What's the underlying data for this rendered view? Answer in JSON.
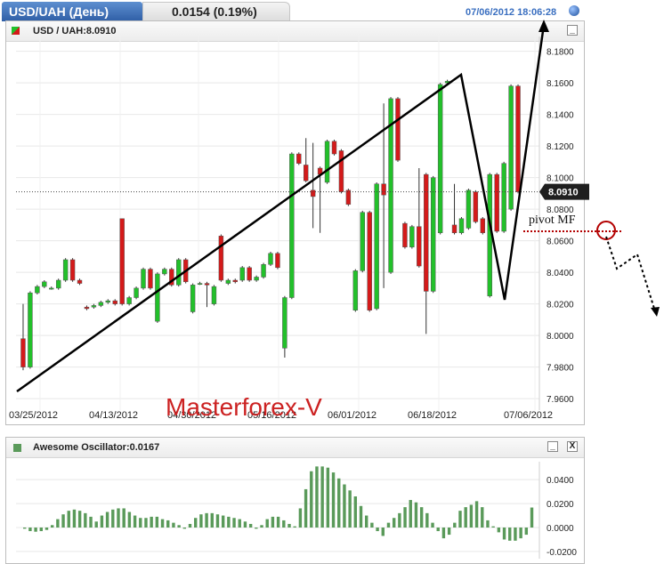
{
  "header": {
    "symbol_tab": "USD/UAH (День)",
    "price_change": "0.0154 (0.19%)",
    "timestamp": "07/06/2012 18:06:28"
  },
  "main_panel": {
    "title": "USD / UAH:8.0910",
    "minimize": "_",
    "last_price_tag": "8.0910",
    "pivot_label": "pivot MF",
    "watermark": "Masterforex-V",
    "colors": {
      "up": "#22c02a",
      "down": "#d41a1a",
      "trendline": "#000000",
      "pivot": "#b30000",
      "tag": "#1f1f1f"
    }
  },
  "osc_panel": {
    "title": "Awesome Oscillator:0.0167",
    "minimize": "_",
    "close": "X",
    "color": "#5a9a5a"
  },
  "chart_data": [
    {
      "type": "candlestick",
      "title": "USD / UAH:8.0910",
      "y_ticks": [
        "8.1800",
        "8.1600",
        "8.1400",
        "8.1200",
        "8.1000",
        "8.0800",
        "8.0600",
        "8.0400",
        "8.0200",
        "8.0000",
        "7.9800",
        "7.9600"
      ],
      "x_ticks": [
        "03/25/2012",
        "04/13/2012",
        "04/30/2012",
        "05/16/2012",
        "06/01/2012",
        "06/18/2012",
        "07/06/2012"
      ],
      "ylim": [
        7.955,
        8.186
      ],
      "candles": [
        [
          7.998,
          7.98,
          8.02,
          7.978
        ],
        [
          7.98,
          8.027,
          8.028,
          7.979
        ],
        [
          8.027,
          8.031,
          8.032,
          8.026
        ],
        [
          8.031,
          8.034,
          8.035,
          8.03
        ],
        [
          8.03,
          8.03,
          8.031,
          8.029
        ],
        [
          8.03,
          8.035,
          8.036,
          8.029
        ],
        [
          8.035,
          8.048,
          8.049,
          8.034
        ],
        [
          8.048,
          8.035,
          8.049,
          8.034
        ],
        [
          8.035,
          8.033,
          8.036,
          8.032
        ],
        [
          8.018,
          8.017,
          8.019,
          8.016
        ],
        [
          8.018,
          8.019,
          8.02,
          8.017
        ],
        [
          8.019,
          8.021,
          8.022,
          8.018
        ],
        [
          8.021,
          8.022,
          8.023,
          8.02
        ],
        [
          8.022,
          8.02,
          8.023,
          8.019
        ],
        [
          8.074,
          8.02,
          8.074,
          8.019
        ],
        [
          8.02,
          8.024,
          8.025,
          8.019
        ],
        [
          8.024,
          8.03,
          8.031,
          8.023
        ],
        [
          8.03,
          8.042,
          8.043,
          8.029
        ],
        [
          8.042,
          8.03,
          8.043,
          8.029
        ],
        [
          8.009,
          8.039,
          8.04,
          8.008
        ],
        [
          8.039,
          8.042,
          8.043,
          8.038
        ],
        [
          8.042,
          8.032,
          8.043,
          8.031
        ],
        [
          8.032,
          8.048,
          8.049,
          8.031
        ],
        [
          8.048,
          8.034,
          8.049,
          8.033
        ],
        [
          8.015,
          8.032,
          8.033,
          8.014
        ],
        [
          8.033,
          8.033,
          8.034,
          8.032
        ],
        [
          8.033,
          8.032,
          8.034,
          8.018
        ],
        [
          8.02,
          8.031,
          8.032,
          8.019
        ],
        [
          8.063,
          8.035,
          8.064,
          8.034
        ],
        [
          8.033,
          8.035,
          8.036,
          8.032
        ],
        [
          8.035,
          8.034,
          8.036,
          8.033
        ],
        [
          8.035,
          8.043,
          8.044,
          8.034
        ],
        [
          8.043,
          8.035,
          8.044,
          8.034
        ],
        [
          8.035,
          8.037,
          8.038,
          8.034
        ],
        [
          8.037,
          8.045,
          8.046,
          8.036
        ],
        [
          8.045,
          8.052,
          8.053,
          8.044
        ],
        [
          8.052,
          8.043,
          8.053,
          8.042
        ],
        [
          7.992,
          8.024,
          8.025,
          7.986
        ],
        [
          8.024,
          8.115,
          8.116,
          8.023
        ],
        [
          8.115,
          8.109,
          8.116,
          8.108
        ],
        [
          8.108,
          8.098,
          8.125,
          8.097
        ],
        [
          8.092,
          8.088,
          8.122,
          8.068
        ],
        [
          8.106,
          8.102,
          8.107,
          8.065
        ],
        [
          8.097,
          8.123,
          8.124,
          8.096
        ],
        [
          8.123,
          8.115,
          8.124,
          8.114
        ],
        [
          8.117,
          8.091,
          8.118,
          8.09
        ],
        [
          8.092,
          8.083,
          8.093,
          8.082
        ],
        [
          8.016,
          8.041,
          8.042,
          8.015
        ],
        [
          8.041,
          8.078,
          8.079,
          8.04
        ],
        [
          8.078,
          8.016,
          8.079,
          8.015
        ],
        [
          8.017,
          8.096,
          8.097,
          8.016
        ],
        [
          8.096,
          8.089,
          8.147,
          8.03
        ],
        [
          8.04,
          8.15,
          8.151,
          8.039
        ],
        [
          8.15,
          8.111,
          8.151,
          8.11
        ],
        [
          8.071,
          8.056,
          8.072,
          8.055
        ],
        [
          8.056,
          8.069,
          8.07,
          8.055
        ],
        [
          8.069,
          8.044,
          8.106,
          8.043
        ],
        [
          8.102,
          8.028,
          8.103,
          8.001
        ],
        [
          8.028,
          8.1,
          8.101,
          8.027
        ],
        [
          8.065,
          8.159,
          8.16,
          8.064
        ],
        [
          8.16,
          8.161,
          8.162,
          8.159
        ],
        [
          8.07,
          8.065,
          8.096,
          8.064
        ],
        [
          8.065,
          8.074,
          8.075,
          8.064
        ],
        [
          8.068,
          8.092,
          8.093,
          8.067
        ],
        [
          8.091,
          8.072,
          8.092,
          8.071
        ],
        [
          8.074,
          8.065,
          8.075,
          8.064
        ],
        [
          8.025,
          8.102,
          8.103,
          8.024
        ],
        [
          8.102,
          8.066,
          8.103,
          8.065
        ],
        [
          8.066,
          8.109,
          8.11,
          8.065
        ],
        [
          8.08,
          8.158,
          8.159,
          8.079
        ],
        [
          8.158,
          8.091,
          8.159,
          8.09
        ]
      ]
    },
    {
      "type": "bar",
      "title": "Awesome Oscillator:0.0167",
      "y_ticks": [
        "0.0400",
        "0.0200",
        "0.0000",
        "-0.0200"
      ],
      "ylim": [
        -0.026,
        0.052
      ],
      "values": [
        -0.001,
        -0.003,
        -0.0035,
        -0.003,
        -0.002,
        0.002,
        0.007,
        0.011,
        0.014,
        0.015,
        0.014,
        0.012,
        0.009,
        0.005,
        0.01,
        0.013,
        0.015,
        0.016,
        0.016,
        0.013,
        0.01,
        0.008,
        0.008,
        0.009,
        0.009,
        0.007,
        0.006,
        0.004,
        0.002,
        -0.001,
        0.003,
        0.008,
        0.011,
        0.012,
        0.012,
        0.011,
        0.01,
        0.009,
        0.008,
        0.007,
        0.005,
        0.003,
        -0.001,
        0.002,
        0.007,
        0.009,
        0.009,
        0.006,
        0.003,
        0.001,
        0.016,
        0.032,
        0.047,
        0.051,
        0.051,
        0.05,
        0.046,
        0.041,
        0.036,
        0.031,
        0.026,
        0.018,
        0.01,
        0.004,
        -0.003,
        -0.007,
        0.004,
        0.008,
        0.012,
        0.017,
        0.023,
        0.021,
        0.017,
        0.012,
        0.004,
        -0.003,
        -0.009,
        -0.006,
        0.004,
        0.014,
        0.017,
        0.019,
        0.022,
        0.017,
        0.006,
        0.001,
        -0.004,
        -0.01,
        -0.011,
        -0.011,
        -0.009,
        -0.006,
        0.0167
      ]
    }
  ]
}
